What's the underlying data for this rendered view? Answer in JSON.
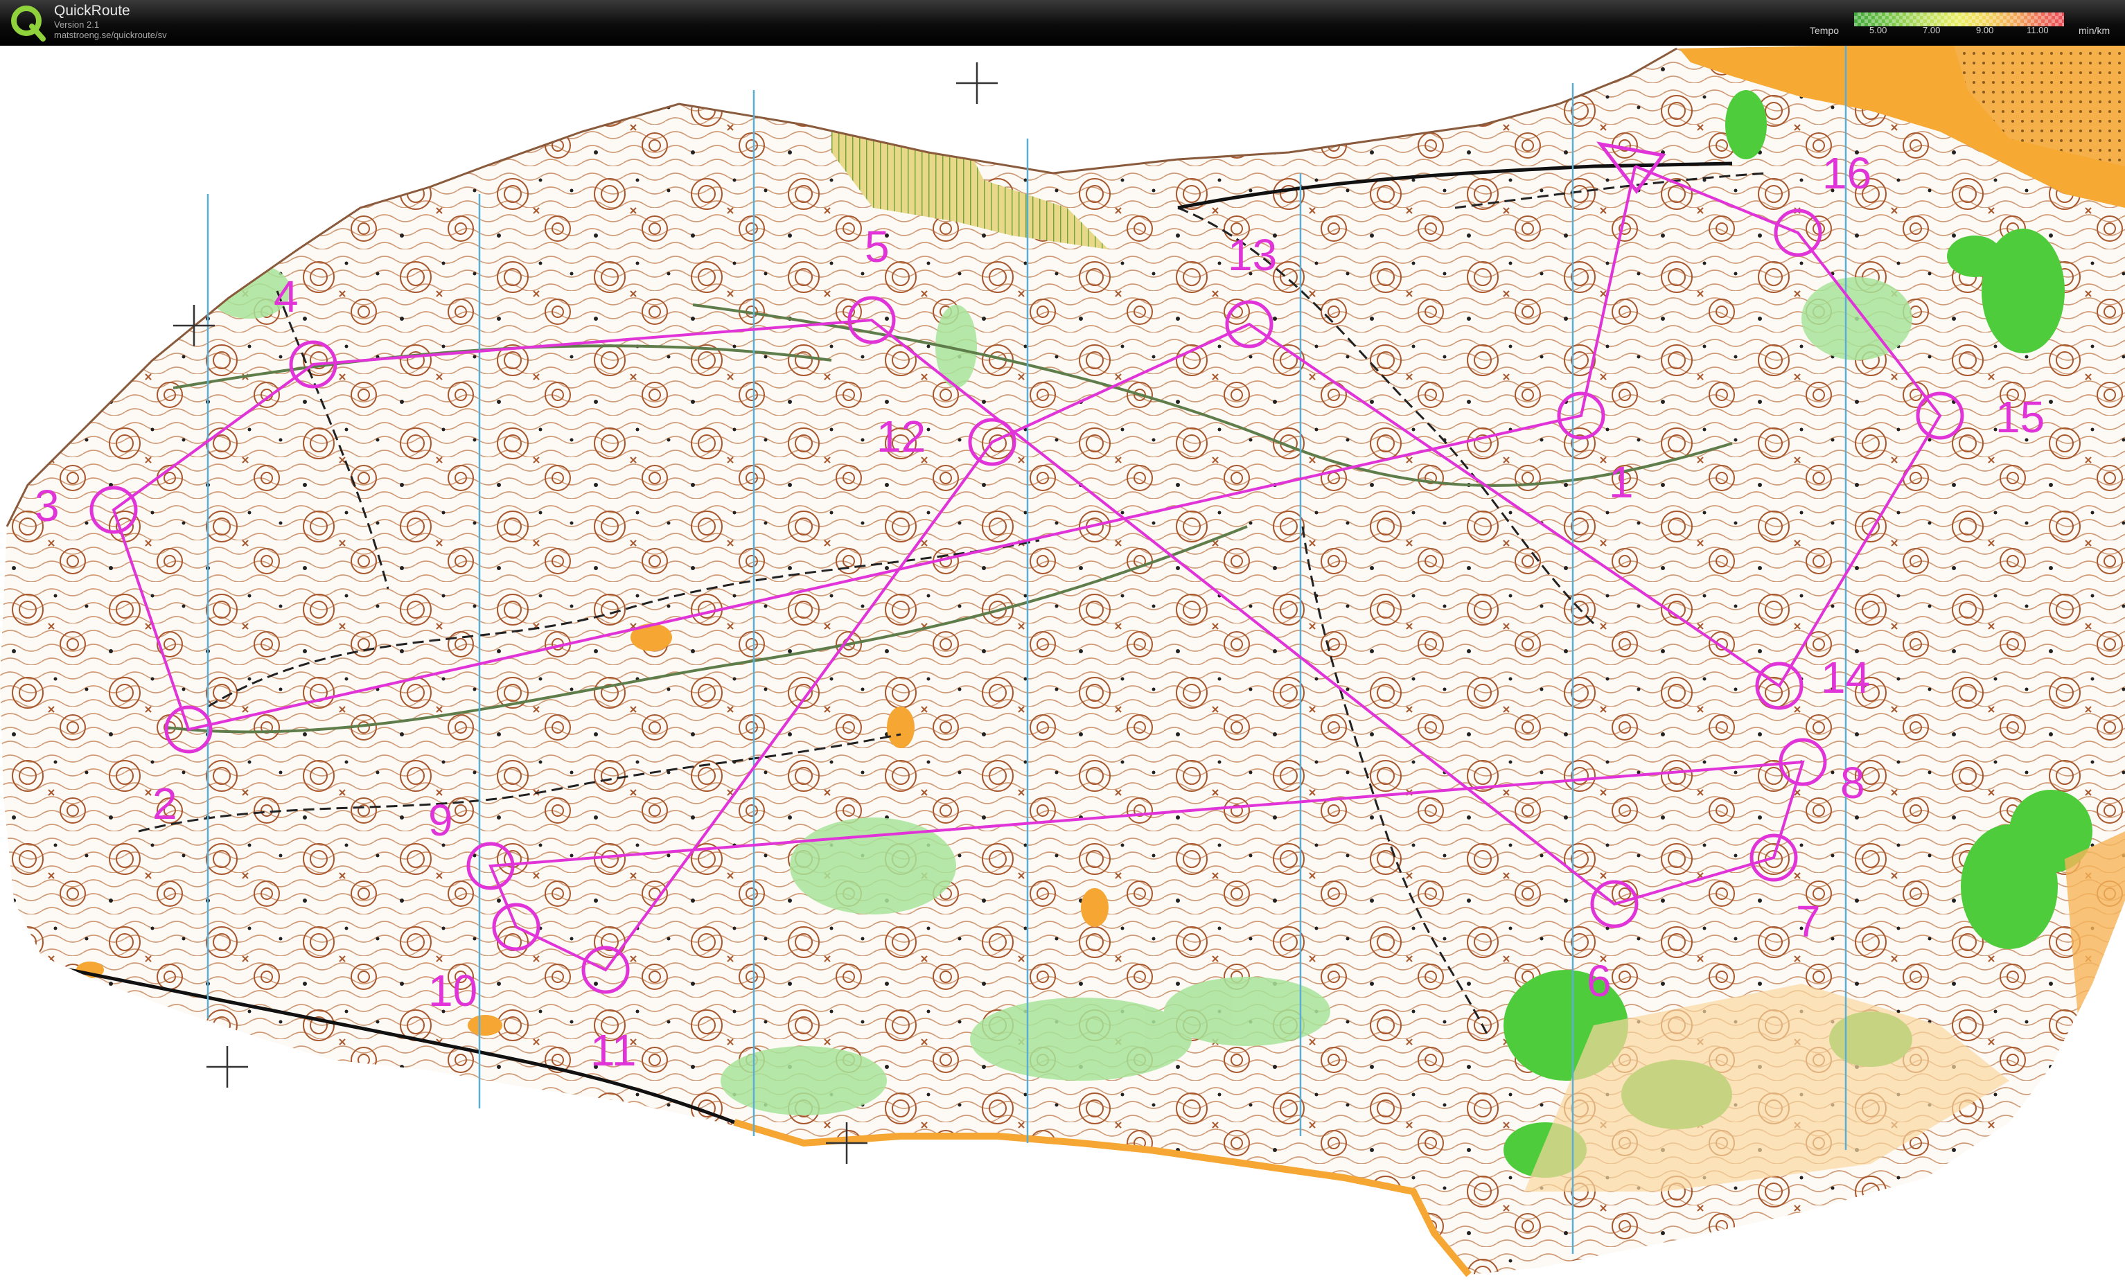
{
  "app": {
    "title": "QuickRoute",
    "version": "Version 2.1",
    "url": "matstroeng.se/quickroute/sv"
  },
  "tempo_legend": {
    "label": "Tempo",
    "ticks": [
      "5.00",
      "7.00",
      "9.00",
      "11.00"
    ],
    "unit": "min/km"
  },
  "colors": {
    "course": "#e034d8",
    "contour": "#b0643a",
    "forest_green": "#46c83a",
    "open_land": "#f5a633",
    "magnetic_north": "#5aaed6"
  },
  "course": {
    "start_label": "start-triangle",
    "controls": [
      {
        "number": "1"
      },
      {
        "number": "2"
      },
      {
        "number": "3"
      },
      {
        "number": "4"
      },
      {
        "number": "5"
      },
      {
        "number": "6"
      },
      {
        "number": "7"
      },
      {
        "number": "8"
      },
      {
        "number": "9"
      },
      {
        "number": "10"
      },
      {
        "number": "11"
      },
      {
        "number": "12"
      },
      {
        "number": "13"
      },
      {
        "number": "14"
      },
      {
        "number": "15"
      },
      {
        "number": "16"
      }
    ]
  }
}
